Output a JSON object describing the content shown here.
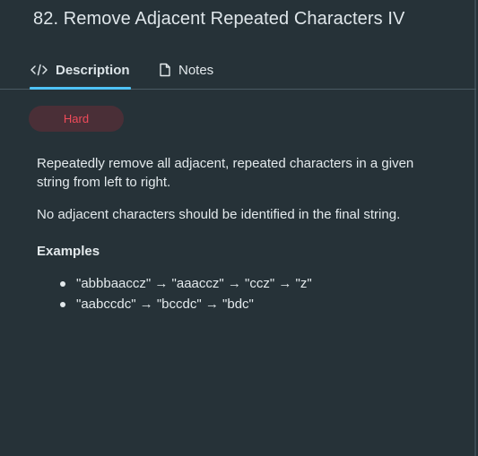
{
  "problem": {
    "title": "82. Remove Adjacent Repeated Characters IV",
    "difficulty": "Hard"
  },
  "tabs": [
    {
      "label": "Description",
      "icon": "code-icon",
      "active": true
    },
    {
      "label": "Notes",
      "icon": "file-icon",
      "active": false
    }
  ],
  "description": {
    "paragraphs": [
      "Repeatedly remove all adjacent, repeated characters in a given string from left to right.",
      "No adjacent characters should be identified in the final string."
    ],
    "examples_heading": "Examples",
    "examples": [
      "\"abbbaaccz\" → \"aaaccz\" → \"ccz\" → \"z\"",
      "\"aabccdc\" → \"bccdc\" → \"bdc\""
    ]
  },
  "colors": {
    "background": "#263238",
    "accent": "#4fc3f7",
    "hard_text": "#f04b5a",
    "hard_bg": "#4a2f37"
  }
}
